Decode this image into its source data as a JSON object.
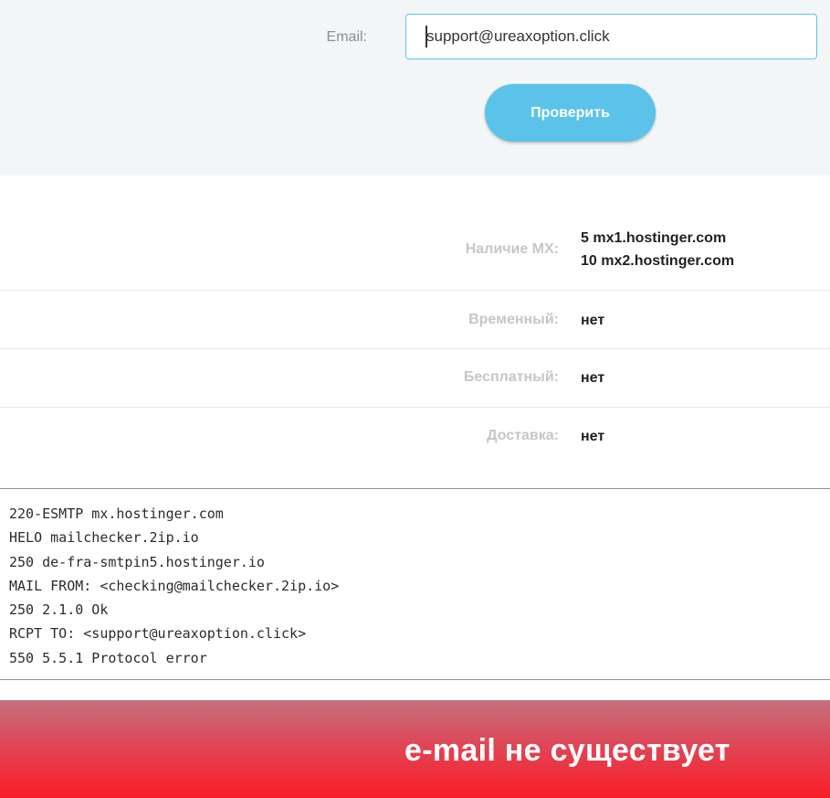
{
  "form": {
    "email_label": "Email:",
    "email_value": "support@ureaxoption.click",
    "check_button_label": "Проверить"
  },
  "results": {
    "mx": {
      "label": "Наличие MX:",
      "values": [
        "5 mx1.hostinger.com",
        "10 mx2.hostinger.com"
      ]
    },
    "temporary": {
      "label": "Временный:",
      "value": "нет"
    },
    "free": {
      "label": "Бесплатный:",
      "value": "нет"
    },
    "delivery": {
      "label": "Доставка:",
      "value": "нет"
    }
  },
  "smtp_log": [
    "220-ESMTP mx.hostinger.com",
    "HELO mailchecker.2ip.io",
    "250 de-fra-smtpin5.hostinger.io",
    "MAIL FROM: <checking@mailchecker.2ip.io>",
    "250 2.1.0 Ok",
    "RCPT TO: <support@ureaxoption.click>",
    "550 5.5.1 Protocol error"
  ],
  "status_banner": {
    "text": "e-mail не существует"
  },
  "colors": {
    "accent": "#5bc3ea",
    "form_background": "#f3f6f7",
    "banner_top": "#c3717c",
    "banner_bottom": "#f91c29"
  }
}
